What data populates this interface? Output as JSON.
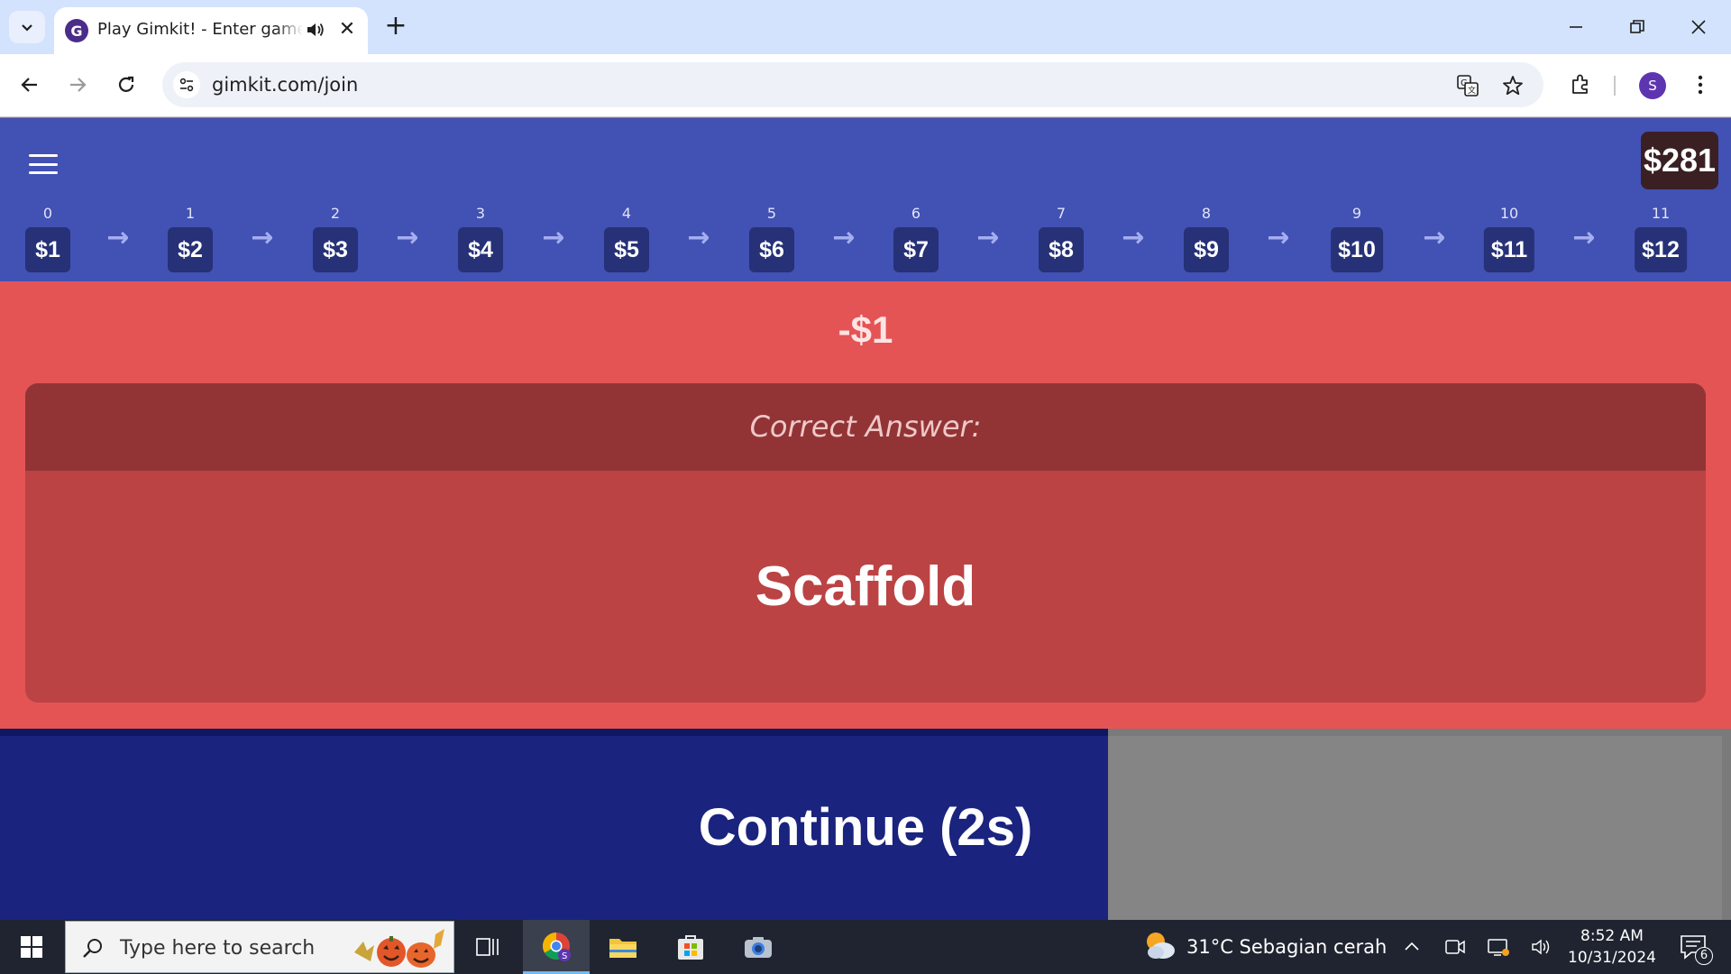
{
  "browser": {
    "tab": {
      "title": "Play Gimkit! - Enter game code",
      "close": "✕"
    },
    "new_tab": "+",
    "url": "gimkit.com/join",
    "profile_initial": "S"
  },
  "game": {
    "balance": "$281",
    "upgrade_track": [
      {
        "level": "0",
        "value": "$1"
      },
      {
        "level": "1",
        "value": "$2"
      },
      {
        "level": "2",
        "value": "$3"
      },
      {
        "level": "3",
        "value": "$4"
      },
      {
        "level": "4",
        "value": "$5"
      },
      {
        "level": "5",
        "value": "$6"
      },
      {
        "level": "6",
        "value": "$7"
      },
      {
        "level": "7",
        "value": "$8"
      },
      {
        "level": "8",
        "value": "$9"
      },
      {
        "level": "9",
        "value": "$10"
      },
      {
        "level": "10",
        "value": "$11"
      },
      {
        "level": "11",
        "value": "$12"
      }
    ],
    "arrow_glyph": "→",
    "delta": "-$1",
    "correct_answer_label": "Correct Answer:",
    "correct_answer": "Scaffold",
    "continue_label": "Continue (2s)",
    "continue_progress": 0.64
  },
  "taskbar": {
    "search_placeholder": "Type here to search",
    "weather": "31°C  Sebagian cerah",
    "time": "8:52 AM",
    "date": "10/31/2024",
    "notification_count": "6"
  },
  "colors": {
    "header_blue": "#4251b4",
    "wrong_red": "#e45455",
    "continue_navy": "#1a237e",
    "balance_bg": "#3a2023"
  }
}
